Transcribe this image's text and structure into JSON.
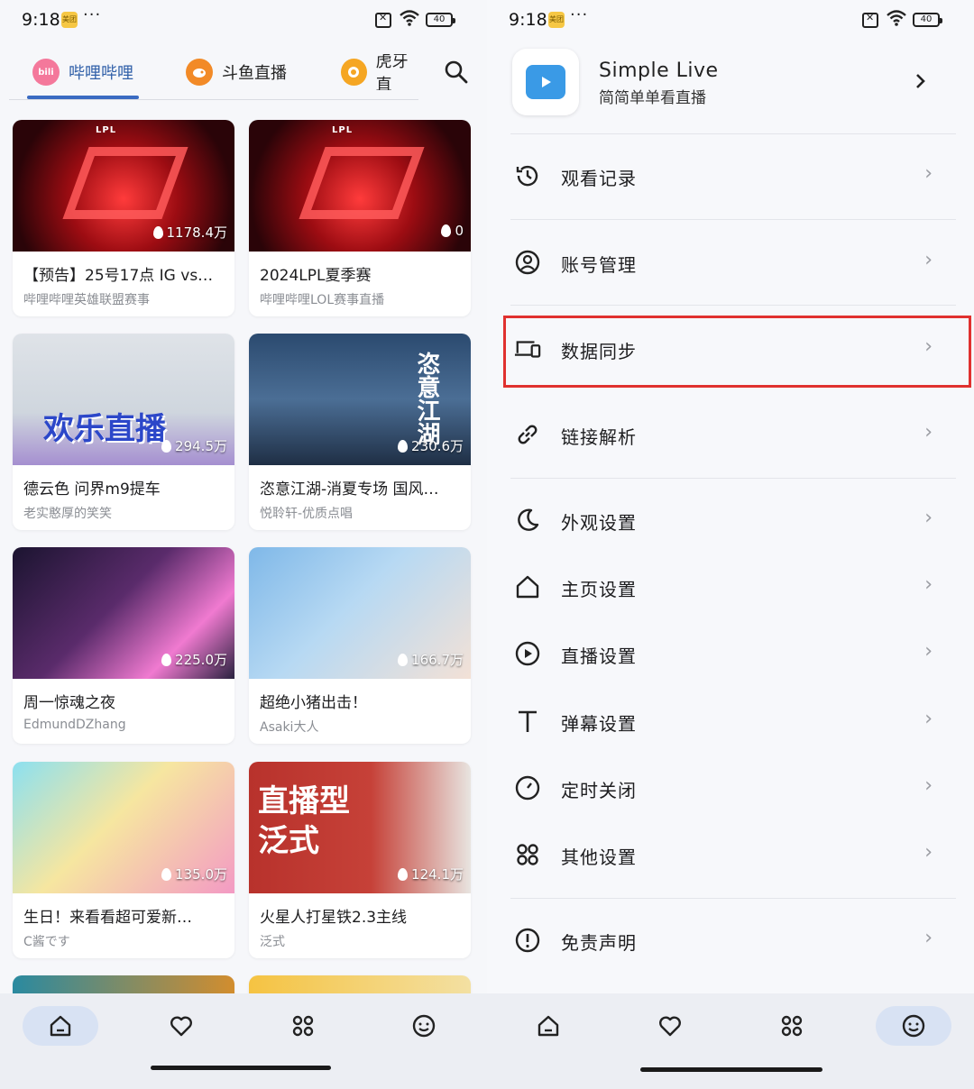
{
  "left_phone": {
    "status": {
      "time": "9:18",
      "badge": "美团",
      "dots": "···",
      "battery": "40"
    },
    "tabs": [
      {
        "label": "哔哩哔哩",
        "logo": "bili",
        "active": true
      },
      {
        "label": "斗鱼直播",
        "logo": "",
        "active": false
      },
      {
        "label": "虎牙直",
        "logo": "",
        "active": false
      }
    ],
    "cards": [
      {
        "title": "【预告】25号17点 IG vs…",
        "subtitle": "哔哩哔哩英雄联盟赛事",
        "views": "1178.4万",
        "art": "LPL"
      },
      {
        "title": "2024LPL夏季赛",
        "subtitle": "哔哩哔哩LOL赛事直播",
        "views": "0",
        "art": "LPL"
      },
      {
        "title": "德云色  问界m9提车",
        "subtitle": "老实憨厚的笑笑",
        "views": "294.5万",
        "art": "欢乐直播"
      },
      {
        "title": "恣意江湖-消夏专场 国风…",
        "subtitle": "悦聆轩-优质点唱",
        "views": "230.6万",
        "art": "恣意江湖"
      },
      {
        "title": "周一惊魂之夜",
        "subtitle": "EdmundDZhang",
        "views": "225.0万",
        "art": ""
      },
      {
        "title": "超绝小猪出击！",
        "subtitle": "Asaki大人",
        "views": "166.7万",
        "art": ""
      },
      {
        "title": "生日！来看看超可爱新…",
        "subtitle": "C酱です",
        "views": "135.0万",
        "art": ""
      },
      {
        "title": "火星人打星铁2.3主线",
        "subtitle": "泛式",
        "views": "124.1万",
        "art": "直播型泛式"
      }
    ],
    "nav": [
      {
        "icon": "home-icon",
        "active": true
      },
      {
        "icon": "heart-icon",
        "active": false
      },
      {
        "icon": "apps-icon",
        "active": false
      },
      {
        "icon": "smile-icon",
        "active": false
      }
    ]
  },
  "right_phone": {
    "status": {
      "time": "9:18",
      "badge": "美团",
      "dots": "···",
      "battery": "40"
    },
    "app": {
      "name": "Simple Live",
      "tagline": "简简单单看直播"
    },
    "menu": [
      {
        "label": "观看记录",
        "icon": "history-icon"
      },
      {
        "label": "账号管理",
        "icon": "account-icon"
      },
      {
        "label": "数据同步",
        "icon": "devices-icon",
        "highlighted": true
      },
      {
        "label": "链接解析",
        "icon": "link-icon"
      },
      {
        "label": "外观设置",
        "icon": "moon-icon"
      },
      {
        "label": "主页设置",
        "icon": "home-icon"
      },
      {
        "label": "直播设置",
        "icon": "play-circle-icon"
      },
      {
        "label": "弹幕设置",
        "icon": "text-icon"
      },
      {
        "label": "定时关闭",
        "icon": "timer-icon"
      },
      {
        "label": "其他设置",
        "icon": "apps-icon"
      },
      {
        "label": "免责声明",
        "icon": "alert-icon"
      }
    ],
    "nav": [
      {
        "icon": "home-icon",
        "active": false
      },
      {
        "icon": "heart-icon",
        "active": false
      },
      {
        "icon": "apps-icon",
        "active": false
      },
      {
        "icon": "smile-icon",
        "active": true
      }
    ]
  },
  "colors": {
    "accent": "#3a6bc2",
    "highlight": "#e0312f",
    "nav_active": "#d8e2f3"
  }
}
